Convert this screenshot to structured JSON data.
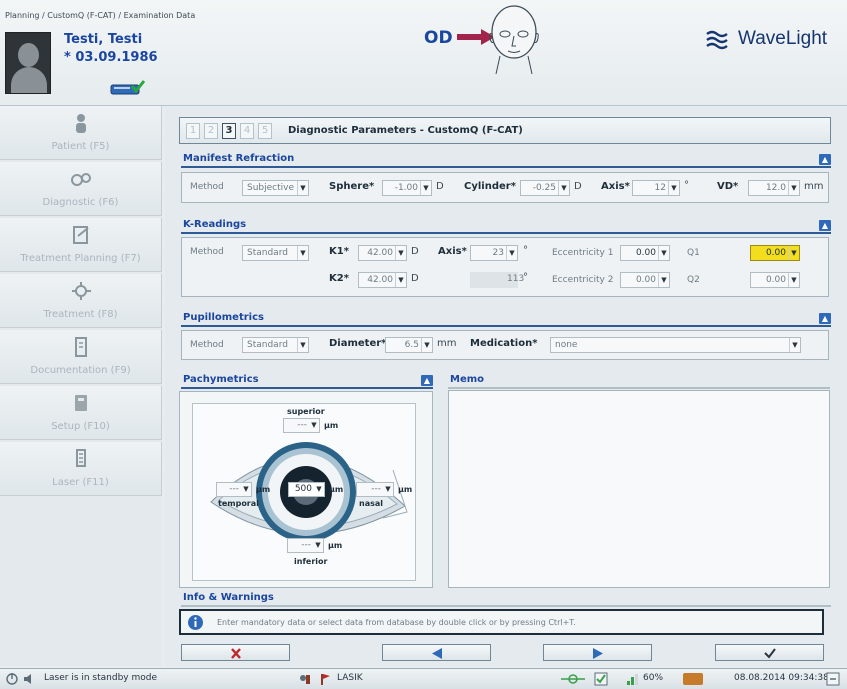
{
  "header": {
    "breadcrumb": "Planning / CustomQ (F-CAT) / Examination Data",
    "patient_name": "Testi, Testi",
    "patient_dob": "* 03.09.1986",
    "eye_label": "OD",
    "brand": "WaveLight"
  },
  "sidebar": {
    "items": [
      {
        "label": "Patient (F5)",
        "icon": "person-icon"
      },
      {
        "label": "Diagnostic (F6)",
        "icon": "diagnostic-icon"
      },
      {
        "label": "Treatment Planning (F7)",
        "icon": "planning-icon"
      },
      {
        "label": "Treatment (F8)",
        "icon": "treatment-icon"
      },
      {
        "label": "Documentation (F9)",
        "icon": "documentation-icon"
      },
      {
        "label": "Setup (F10)",
        "icon": "setup-icon"
      },
      {
        "label": "Laser (F11)",
        "icon": "laser-icon"
      }
    ]
  },
  "steps": {
    "numbers": [
      "1",
      "2",
      "3",
      "4",
      "5"
    ],
    "active": "3",
    "title": "Diagnostic Parameters - CustomQ (F-CAT)"
  },
  "manifest": {
    "title": "Manifest Refraction",
    "method_label": "Method",
    "method_value": "Subjective",
    "sphere_label": "Sphere*",
    "sphere_value": "-1.00",
    "sphere_unit": "D",
    "cylinder_label": "Cylinder*",
    "cylinder_value": "-0.25",
    "cylinder_unit": "D",
    "axis_label": "Axis*",
    "axis_value": "12",
    "axis_unit": "°",
    "vd_label": "VD*",
    "vd_value": "12.0",
    "vd_unit": "mm"
  },
  "kreadings": {
    "title": "K-Readings",
    "method_label": "Method",
    "method_value": "Standard",
    "k1_label": "K1*",
    "k1_value": "42.00",
    "k1_unit": "D",
    "k2_label": "K2*",
    "k2_value": "42.00",
    "k2_unit": "D",
    "axis_label": "Axis*",
    "axis_value": "23",
    "axis_unit": "°",
    "axis2_value": "113",
    "axis2_unit": "°",
    "ecc1_label": "Eccentricity 1",
    "ecc1_value": "0.00",
    "ecc2_label": "Eccentricity 2",
    "ecc2_value": "0.00",
    "q1_label": "Q1",
    "q1_value": "0.00",
    "q2_label": "Q2",
    "q2_value": "0.00"
  },
  "pupillometrics": {
    "title": "Pupillometrics",
    "method_label": "Method",
    "method_value": "Standard",
    "diameter_label": "Diameter*",
    "diameter_value": "6.5",
    "diameter_unit": "mm",
    "medication_label": "Medication*",
    "medication_value": "none"
  },
  "pachymetrics": {
    "title": "Pachymetrics",
    "superior_label": "superior",
    "inferior_label": "inferior",
    "temporal_label": "temporal",
    "nasal_label": "nasal",
    "superior_value": "---",
    "inferior_value": "---",
    "temporal_value": "---",
    "nasal_value": "---",
    "center_value": "500",
    "unit": "µm"
  },
  "memo": {
    "title": "Memo"
  },
  "info": {
    "title": "Info & Warnings",
    "message": "Enter mandatory data or select data from database by double click or by pressing Ctrl+T."
  },
  "statusbar": {
    "laser_status": "Laser is in standby mode",
    "mode": "LASIK",
    "percent": "60%",
    "datetime": "08.08.2014 09:34:38"
  },
  "colors": {
    "accent_blue": "#1b46a0",
    "highlight_yellow": "#f2de1e",
    "cancel_red": "#c0262a",
    "nav_blue": "#2f6ab8"
  }
}
